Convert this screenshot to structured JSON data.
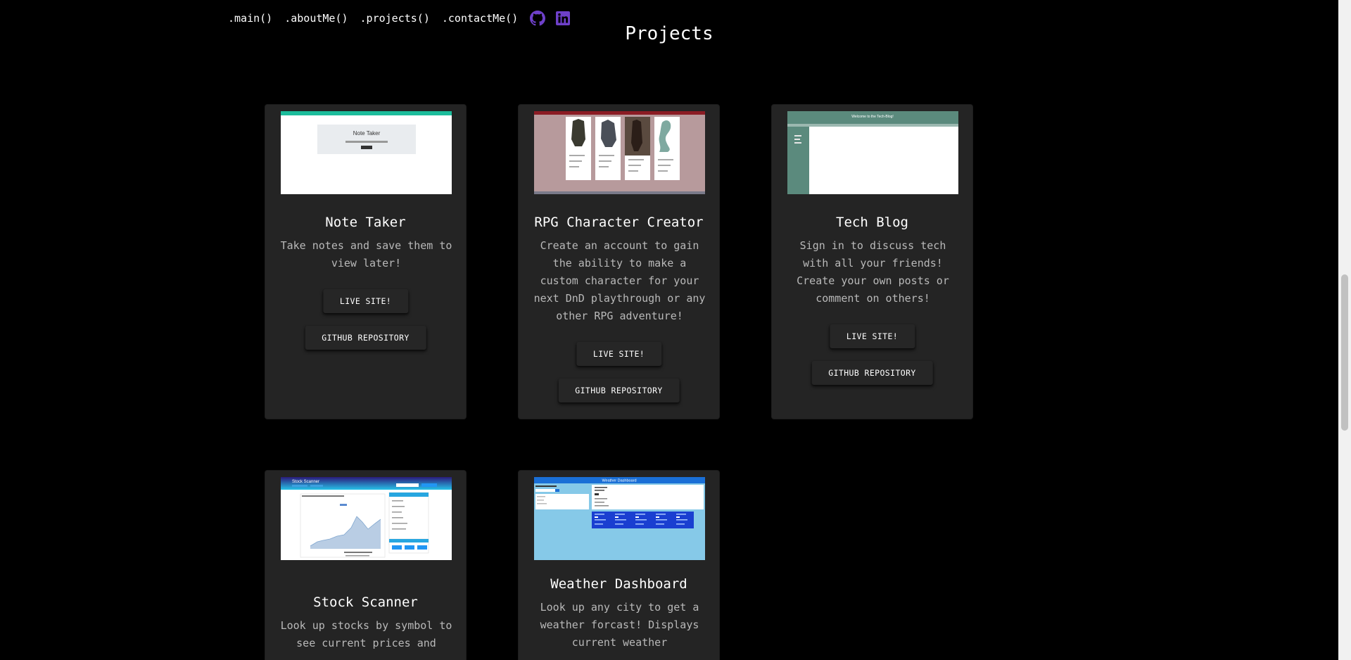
{
  "nav": {
    "links": [
      ".main()",
      ".aboutMe()",
      ".projects()",
      ".contactMe()"
    ],
    "github_icon_color": "#6e40c9",
    "linkedin_icon_color": "#6e40c9"
  },
  "section": {
    "title": "Projects"
  },
  "cards": [
    {
      "title": "Note Taker",
      "description": "Take notes and save them to view later!",
      "live_label": "LIVE SITE!",
      "repo_label": "GITHUB REPOSITORY",
      "thumb_title": "Note Taker"
    },
    {
      "title": "RPG Character Creator",
      "description": "Create an account to gain the ability to make a custom character for your next DnD playthrough or any other RPG adventure!",
      "live_label": "LIVE SITE!",
      "repo_label": "GITHUB REPOSITORY"
    },
    {
      "title": "Tech Blog",
      "description": "Sign in to discuss tech with all your friends! Create your own posts or comment on others!",
      "live_label": "LIVE SITE!",
      "repo_label": "GITHUB REPOSITORY",
      "thumb_title": "Welcome to the Tech-Blog!"
    },
    {
      "title": "Stock Scanner",
      "description": "Look up stocks by symbol to see current prices and",
      "thumb_title": "Stock Scanner"
    },
    {
      "title": "Weather Dashboard",
      "description": "Look up any city to get a weather forcast! Displays current weather",
      "thumb_title": "Weather Dashboard"
    }
  ]
}
